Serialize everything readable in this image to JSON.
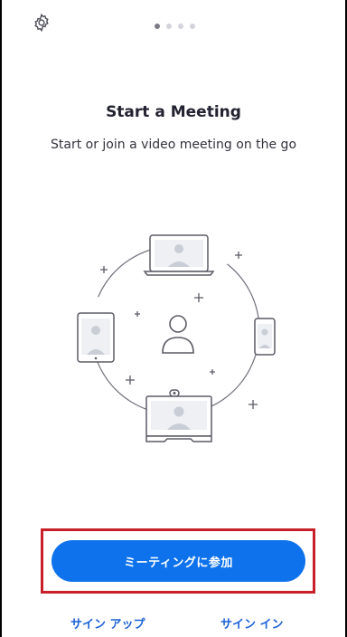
{
  "header": {
    "settings_icon": "gear-icon",
    "pager": {
      "total": 4,
      "active": 0
    }
  },
  "onboarding": {
    "title": "Start a Meeting",
    "subtitle": "Start or join a video meeting on the go",
    "illustration_icons": [
      "laptop-icon",
      "tablet-icon",
      "person-icon",
      "phone-icon",
      "video-room-icon",
      "plus-icon"
    ]
  },
  "actions": {
    "join_label": "ミーティングに参加",
    "signup_label": "サイン アップ",
    "signin_label": "サイン イン"
  },
  "colors": {
    "accent": "#0e72ed",
    "link": "#1d62d6",
    "highlight": "#c8202a",
    "illustration_stroke": "#5b5b66"
  }
}
